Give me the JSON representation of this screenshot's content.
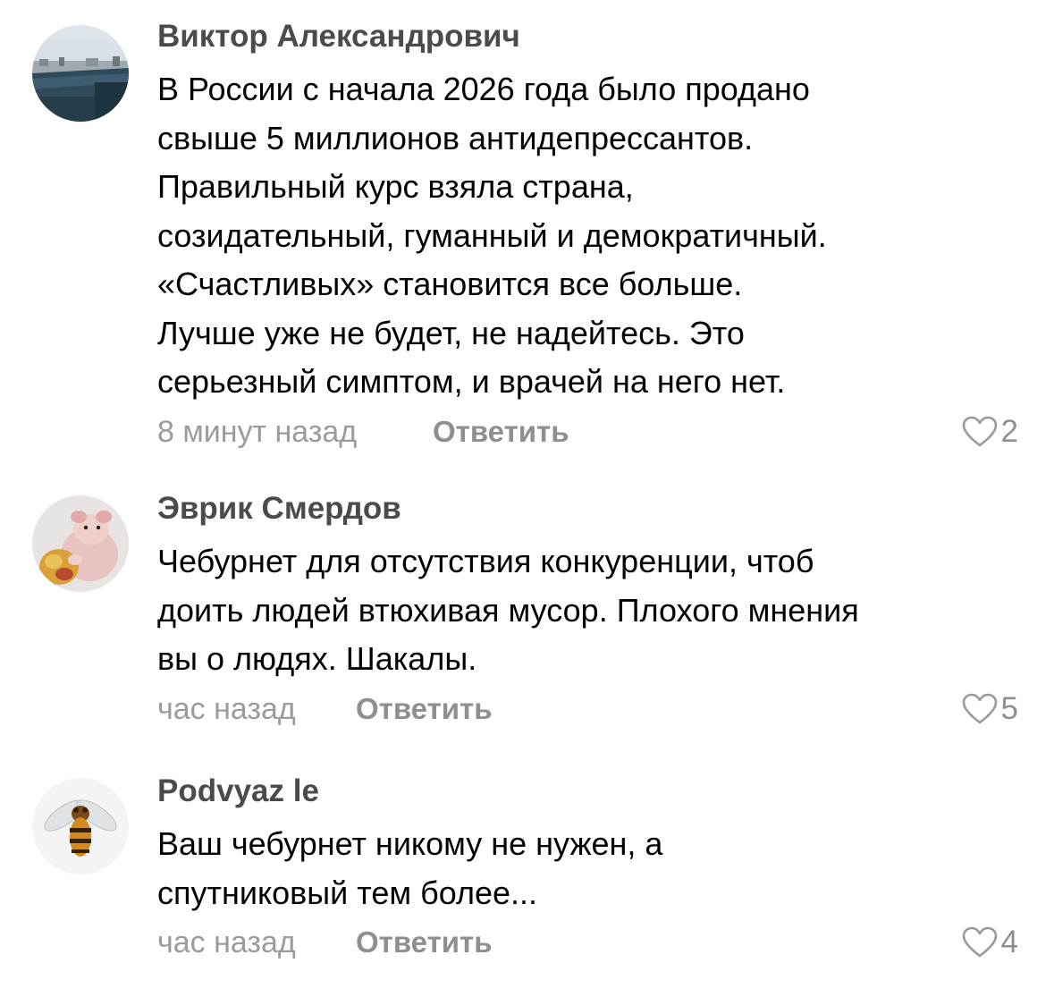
{
  "comments": [
    {
      "author": "Виктор Александрович",
      "text_lines": [
        "В России с начала 2026 года было продано",
        "свыше 5 миллионов антидепрессантов.",
        "Правильный курс взяла страна,",
        "созидательный, гуманный и демократичный.",
        "«Счастливых» становится все больше.",
        "Лучше уже не будет, не надейтесь. Это",
        "серьезный симптом, и врачей на него нет."
      ],
      "time": "8 минут назад",
      "reply_label": "Ответить",
      "likes": "2",
      "avatar_icon": "city-photo-avatar"
    },
    {
      "author": "Эврик Смердов",
      "text_lines": [
        "Чебурнет для отсутствия конкуренции, чтоб",
        "доить людей втюхивая мусор. Плохого мнения",
        "вы о людях. Шакалы."
      ],
      "time": "час назад",
      "reply_label": "Ответить",
      "likes": "5",
      "avatar_icon": "hairless-rat-avatar"
    },
    {
      "author": "Podvyaz le",
      "text_lines": [
        "Ваш чебурнет никому не нужен, а",
        "спутниковый тем более..."
      ],
      "time": "час назад",
      "reply_label": "Ответить",
      "likes": "4",
      "avatar_icon": "hoverfly-avatar"
    }
  ],
  "colors": {
    "author": "#4a4a4f",
    "text": "#000000",
    "meta": "#9a9a9f",
    "reply": "#8e8e93",
    "heart": "#9a9a9f"
  }
}
